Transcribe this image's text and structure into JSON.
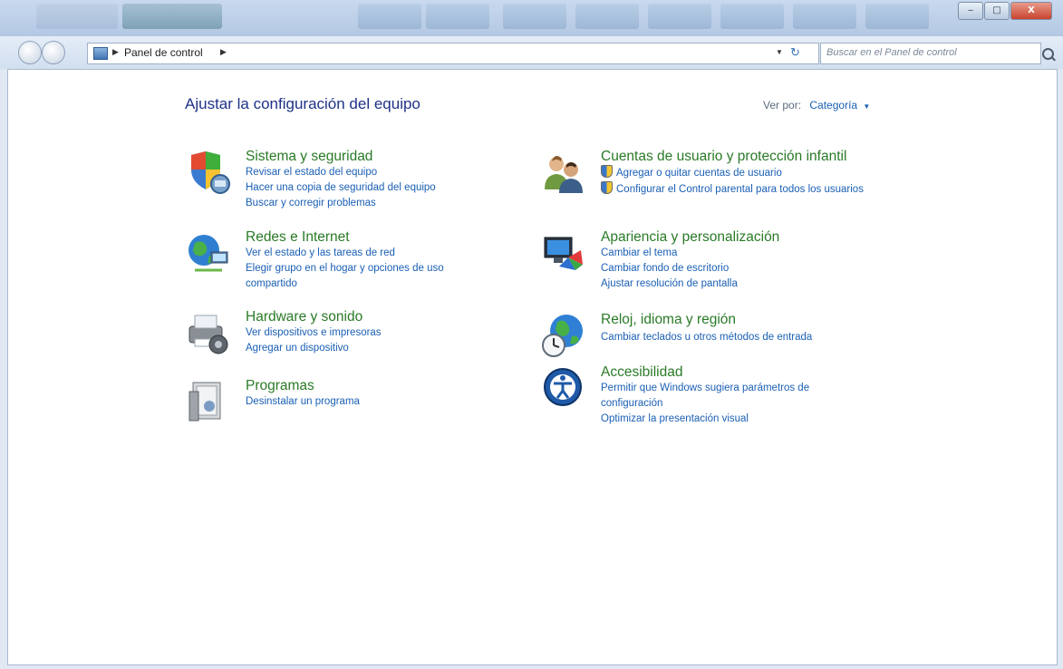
{
  "window": {
    "minimize_glyph": "‒",
    "maximize_glyph": "□",
    "close_glyph": "X"
  },
  "address": {
    "path": "Panel de control",
    "search_placeholder": "Buscar en el Panel de control"
  },
  "page": {
    "title": "Ajustar la configuración del equipo",
    "view_by_label": "Ver por:",
    "view_by_value": "Categoría"
  },
  "categories": {
    "sistema": {
      "title": "Sistema y seguridad",
      "icon": "shield-pc-icon",
      "links": [
        "Revisar el estado del equipo",
        "Hacer una copia de seguridad del equipo",
        "Buscar y corregir problemas"
      ]
    },
    "redes": {
      "title": "Redes e Internet",
      "icon": "network-globe-icon",
      "links": [
        "Ver el estado y las tareas de red",
        "Elegir grupo en el hogar y opciones de uso compartido"
      ]
    },
    "hardware": {
      "title": "Hardware y sonido",
      "icon": "printer-speaker-icon",
      "links": [
        "Ver dispositivos e impresoras",
        "Agregar un dispositivo"
      ]
    },
    "programas": {
      "title": "Programas",
      "icon": "programs-box-icon",
      "links": [
        "Desinstalar un programa"
      ]
    },
    "cuentas": {
      "title": "Cuentas de usuario y protección infantil",
      "icon": "users-icon",
      "links": [
        "Agregar o quitar cuentas de usuario",
        "Configurar el Control parental para todos los usuarios"
      ]
    },
    "apariencia": {
      "title": "Apariencia y personalización",
      "icon": "monitor-paint-icon",
      "links": [
        "Cambiar el tema",
        "Cambiar fondo de escritorio",
        "Ajustar resolución de pantalla"
      ]
    },
    "reloj": {
      "title": "Reloj, idioma y región",
      "icon": "globe-clock-icon",
      "links": [
        "Cambiar teclados u otros métodos de entrada"
      ]
    },
    "accesibilidad": {
      "title": "Accesibilidad",
      "icon": "accessibility-icon",
      "links": [
        "Permitir que Windows sugiera parámetros de configuración",
        "Optimizar la presentación visual"
      ]
    }
  },
  "colors": {
    "category_title": "#2a7a27",
    "link": "#1a5fb4",
    "page_title": "#1e3287"
  }
}
